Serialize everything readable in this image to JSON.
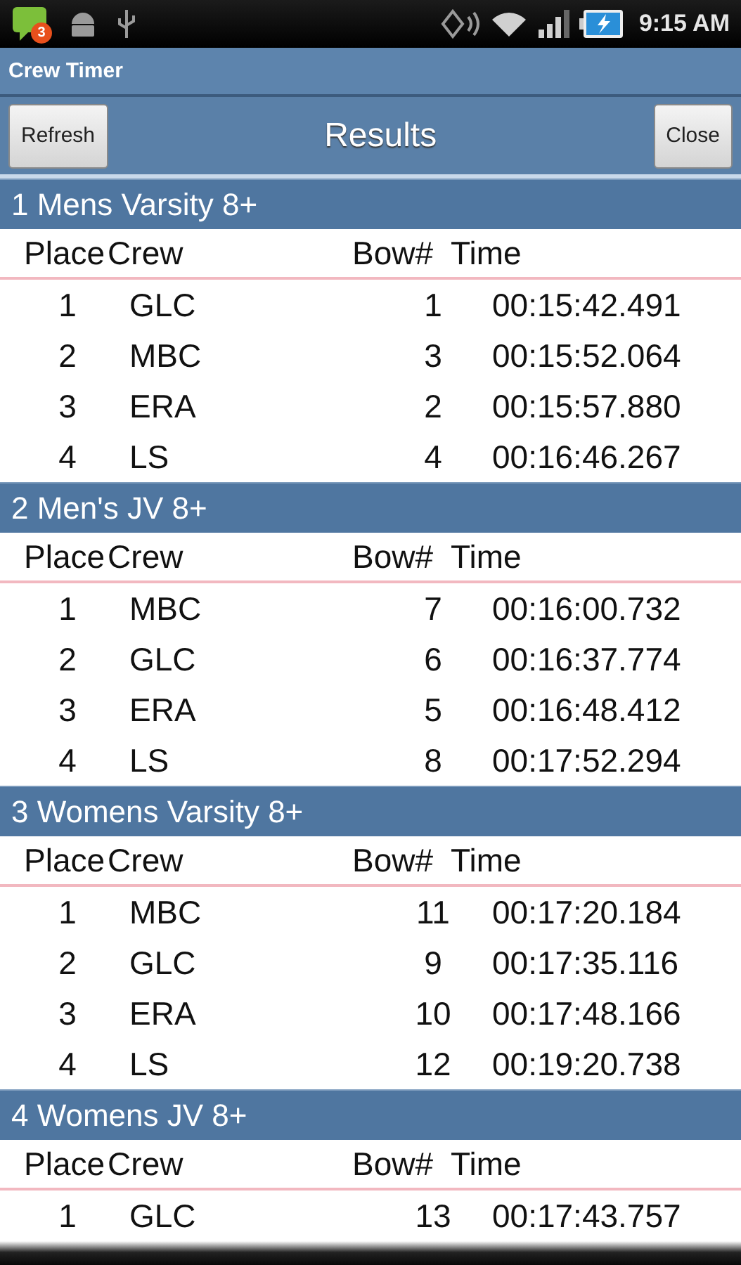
{
  "status_bar": {
    "notification_count": "3",
    "time": "9:15 AM"
  },
  "app_title": "Crew Timer",
  "toolbar": {
    "left_button": "Refresh",
    "title": "Results",
    "right_button": "Close"
  },
  "races": [
    {
      "title": "1 Mens Varsity 8+",
      "columns": [
        "Place",
        "Crew",
        "Bow#",
        "Time"
      ],
      "rows": [
        [
          "1",
          "GLC",
          "1",
          "00:15:42.491"
        ],
        [
          "2",
          "MBC",
          "3",
          "00:15:52.064"
        ],
        [
          "3",
          "ERA",
          "2",
          "00:15:57.880"
        ],
        [
          "4",
          "LS",
          "4",
          "00:16:46.267"
        ]
      ]
    },
    {
      "title": "2 Men's JV 8+",
      "columns": [
        "Place",
        "Crew",
        "Bow#",
        "Time"
      ],
      "rows": [
        [
          "1",
          "MBC",
          "7",
          "00:16:00.732"
        ],
        [
          "2",
          "GLC",
          "6",
          "00:16:37.774"
        ],
        [
          "3",
          "ERA",
          "5",
          "00:16:48.412"
        ],
        [
          "4",
          "LS",
          "8",
          "00:17:52.294"
        ]
      ]
    },
    {
      "title": "3 Womens Varsity 8+",
      "columns": [
        "Place",
        "Crew",
        "Bow#",
        "Time"
      ],
      "rows": [
        [
          "1",
          "MBC",
          "11",
          "00:17:20.184"
        ],
        [
          "2",
          "GLC",
          "9",
          "00:17:35.116"
        ],
        [
          "3",
          "ERA",
          "10",
          "00:17:48.166"
        ],
        [
          "4",
          "LS",
          "12",
          "00:19:20.738"
        ]
      ]
    },
    {
      "title": "4 Womens JV 8+",
      "columns": [
        "Place",
        "Crew",
        "Bow#",
        "Time"
      ],
      "rows": [
        [
          "1",
          "GLC",
          "13",
          "00:17:43.757"
        ]
      ]
    }
  ]
}
